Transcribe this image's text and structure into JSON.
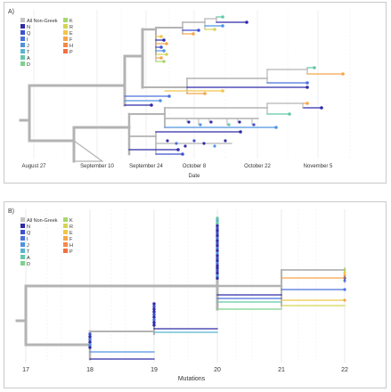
{
  "colors": {
    "All Non-Greek": "#c4c4c4",
    "N": "#2f2aa8",
    "Q": "#3f52cf",
    "I": "#4b72dc",
    "J": "#4f93e0",
    "T": "#58b3cf",
    "A": "#63c7a8",
    "D": "#7ed08d",
    "K": "#a8d66c",
    "R": "#d4d455",
    "E": "#f0c64a",
    "F": "#f6a54b",
    "H": "#f5894a",
    "P": "#f2703f"
  },
  "legend": {
    "col1": [
      "All Non-Greek",
      "N",
      "Q",
      "I",
      "J",
      "T",
      "A",
      "D"
    ],
    "col2": [
      "K",
      "R",
      "E",
      "F",
      "H",
      "P"
    ]
  },
  "panelA": {
    "label": "A)",
    "xlabel": "Date",
    "ticks": [
      "August 27",
      "September 10",
      "September 24",
      "October 8",
      "October 22",
      "November 5"
    ]
  },
  "panelB": {
    "label": "B)",
    "xlabel": "Mutations",
    "ticks": [
      "17",
      "18",
      "19",
      "20",
      "21",
      "22"
    ]
  }
}
